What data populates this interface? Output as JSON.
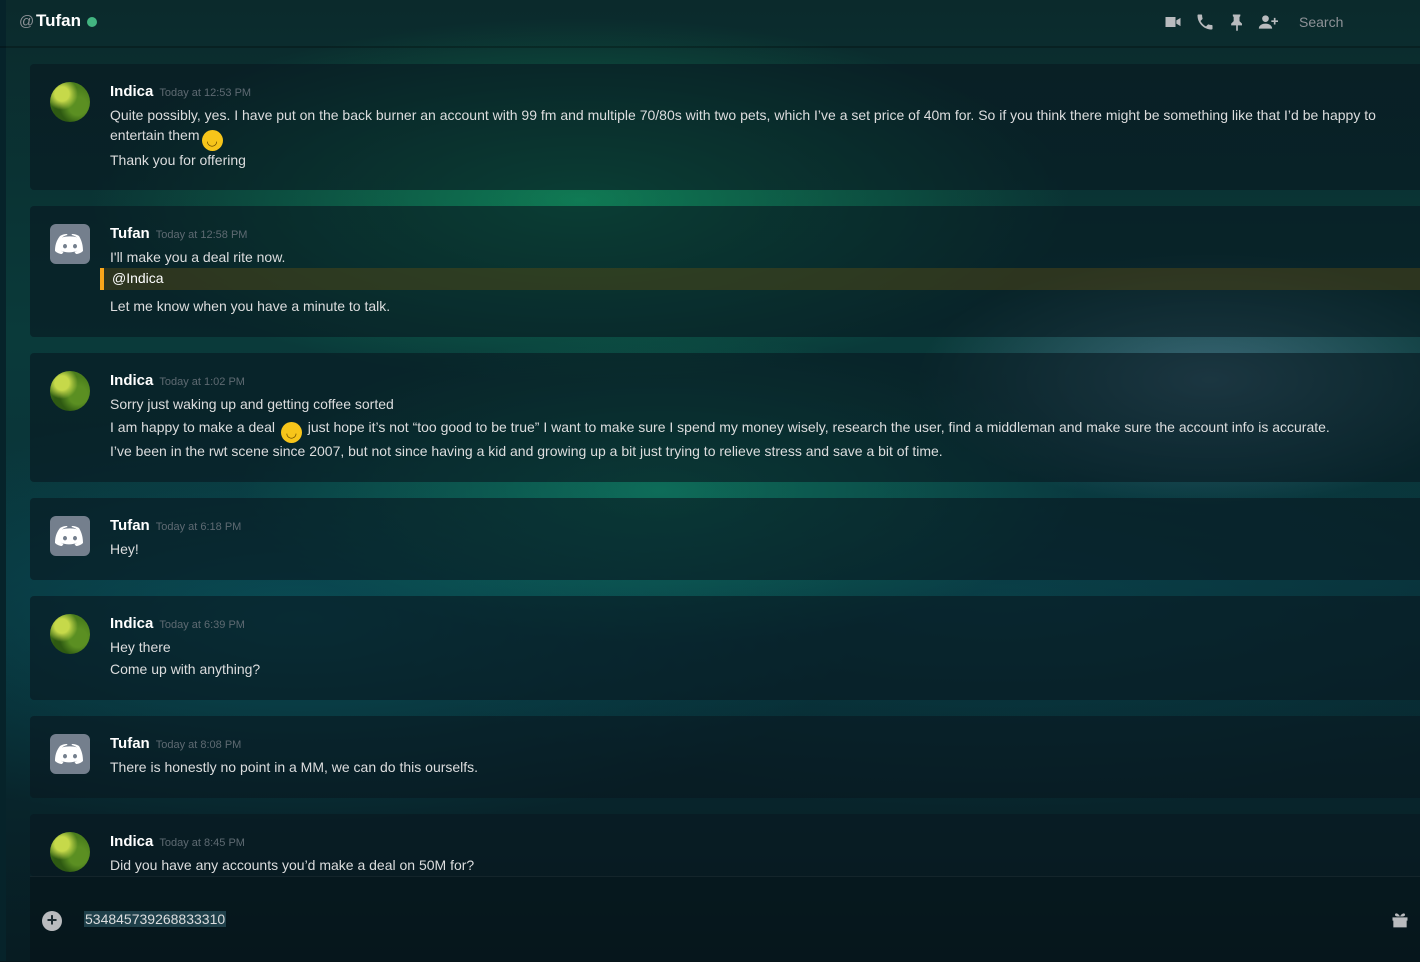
{
  "header": {
    "at_symbol": "@",
    "name": "Tufan",
    "search_placeholder": "Search"
  },
  "messages": [
    {
      "author": "Indica",
      "timestamp": "Today at 12:53 PM",
      "lines": [
        "Quite possibly, yes. I have put on the back burner an account with 99 fm and multiple 70/80s with two pets, which I’ve a set price of 40m for. So if you think there might be something like that I’d be happy to entertain them",
        "Thank you for offering"
      ]
    },
    {
      "author": "Tufan",
      "timestamp": "Today at 12:58 PM",
      "lines": [
        "I'll make you a deal rite now.",
        "@Indica",
        "Let me know when you have a minute to talk."
      ]
    },
    {
      "author": "Indica",
      "timestamp": "Today at 1:02 PM",
      "lines": [
        "Sorry just waking up and getting coffee sorted",
        "I am happy to make a deal",
        "just hope it’s not “too good to be true” I want to make sure I spend my money wisely, research the user, find a middleman and make sure the account info is accurate.",
        "I’ve been in the rwt scene since 2007, but not since having a kid and growing up a bit just trying to relieve stress and save a bit of time."
      ]
    },
    {
      "author": "Tufan",
      "timestamp": "Today at 6:18 PM",
      "lines": [
        "Hey!"
      ]
    },
    {
      "author": "Indica",
      "timestamp": "Today at 6:39 PM",
      "lines": [
        "Hey there",
        "Come up with anything?"
      ]
    },
    {
      "author": "Tufan",
      "timestamp": "Today at 8:08 PM",
      "lines": [
        "There is honestly no point in a MM, we can do this ourselfs."
      ]
    },
    {
      "author": "Indica",
      "timestamp": "Today at 8:45 PM",
      "lines": [
        "Did you have any accounts you’d make a deal on 50M for?"
      ]
    }
  ],
  "composer": {
    "value": "534845739268833310"
  },
  "icons": {
    "status": "online-dot",
    "video": "video-camera-icon",
    "call": "phone-icon",
    "pin": "pin-icon",
    "add_friend": "add-friend-icon",
    "emoji": "smiley-emoji",
    "attach": "plus-circle-icon",
    "gift": "gift-icon",
    "avatar_tufan": "discord-logo-icon",
    "avatar_indica": "leaf-avatar"
  },
  "colors": {
    "online": "#43b581",
    "mention_bar": "#faa61a",
    "mention_bg": "#4a4014"
  }
}
